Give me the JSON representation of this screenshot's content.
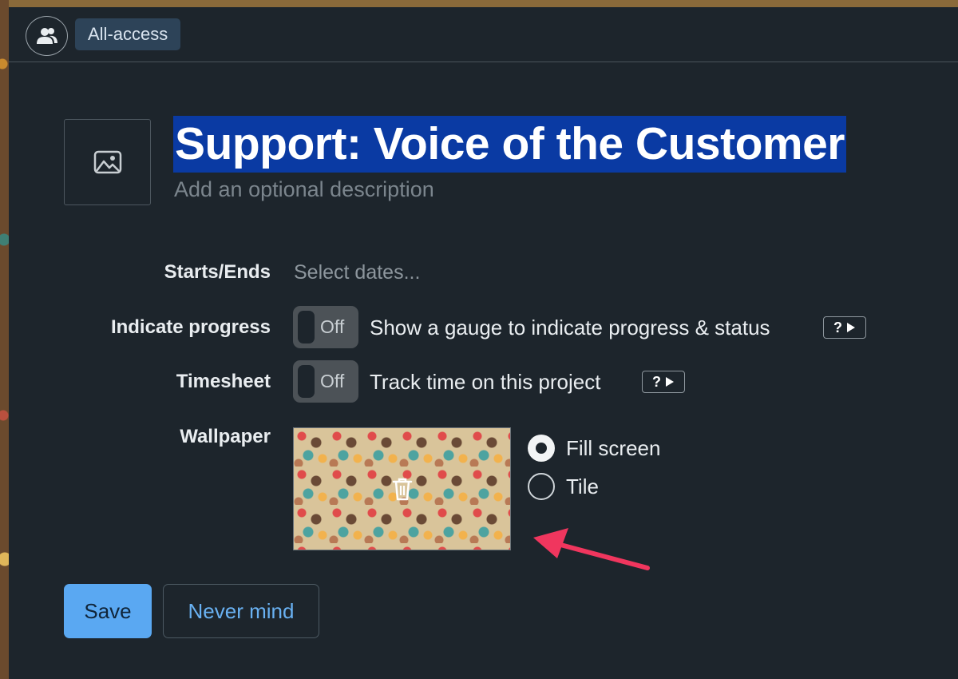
{
  "header": {
    "people_icon": "people-icon",
    "access_label": "All-access"
  },
  "project": {
    "image_placeholder_icon": "image-icon",
    "title": "Support: Voice of the Customer",
    "description_placeholder": "Add an optional description"
  },
  "fields": {
    "dates": {
      "label": "Starts/Ends",
      "placeholder": "Select dates..."
    },
    "progress": {
      "label": "Indicate progress",
      "toggle_state": "Off",
      "text": "Show a gauge to indicate progress & status",
      "help": "?"
    },
    "timesheet": {
      "label": "Timesheet",
      "toggle_state": "Off",
      "text": "Track time on this project",
      "help": "?"
    },
    "wallpaper": {
      "label": "Wallpaper",
      "delete_icon": "trash-icon",
      "options": [
        "Fill screen",
        "Tile"
      ],
      "selected": "Fill screen"
    }
  },
  "actions": {
    "save_label": "Save",
    "cancel_label": "Never mind"
  },
  "colors": {
    "accent": "#5aa8f2",
    "title_highlight": "#0a3aa3",
    "annotation_arrow": "#f0365e"
  }
}
